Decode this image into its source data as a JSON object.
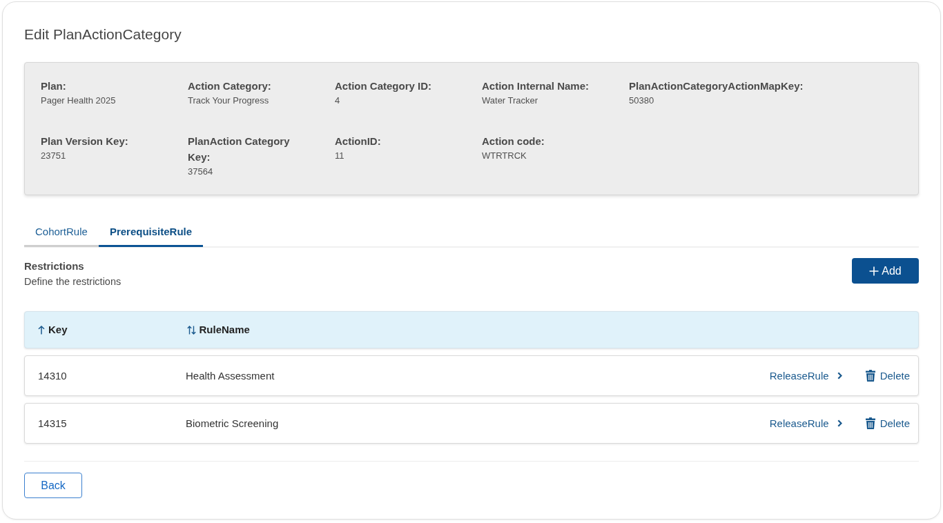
{
  "page": {
    "title": "Edit PlanActionCategory"
  },
  "details": {
    "fields": [
      {
        "label": "Plan:",
        "value": "Pager Health 2025"
      },
      {
        "label": "Action Category:",
        "value": "Track Your Progress"
      },
      {
        "label": "Action Category ID:",
        "value": "4"
      },
      {
        "label": "Action Internal Name:",
        "value": "Water Tracker"
      },
      {
        "label": "PlanActionCategoryActionMapKey:",
        "value": "50380"
      },
      {
        "label": "Plan Version Key:",
        "value": "23751"
      },
      {
        "label": "PlanAction Category Key:",
        "value": "37564"
      },
      {
        "label": "ActionID:",
        "value": "11"
      },
      {
        "label": "Action code:",
        "value": "WTRTRCK"
      }
    ]
  },
  "tabs": [
    {
      "label": "CohortRule",
      "selected": false
    },
    {
      "label": "PrerequisiteRule",
      "selected": true
    }
  ],
  "section": {
    "title": "Restrictions",
    "subtitle": "Define the restrictions",
    "add_button": "Add"
  },
  "table": {
    "columns": [
      {
        "label": "Key",
        "sorted": true
      },
      {
        "label": "RuleName",
        "sorted": false
      }
    ],
    "rows": [
      {
        "key": "14310",
        "rule_name": "Health Assessment",
        "link": "ReleaseRule",
        "delete": "Delete"
      },
      {
        "key": "14315",
        "rule_name": "Biometric Screening",
        "link": "ReleaseRule",
        "delete": "Delete"
      }
    ]
  },
  "back_button": "Back"
}
